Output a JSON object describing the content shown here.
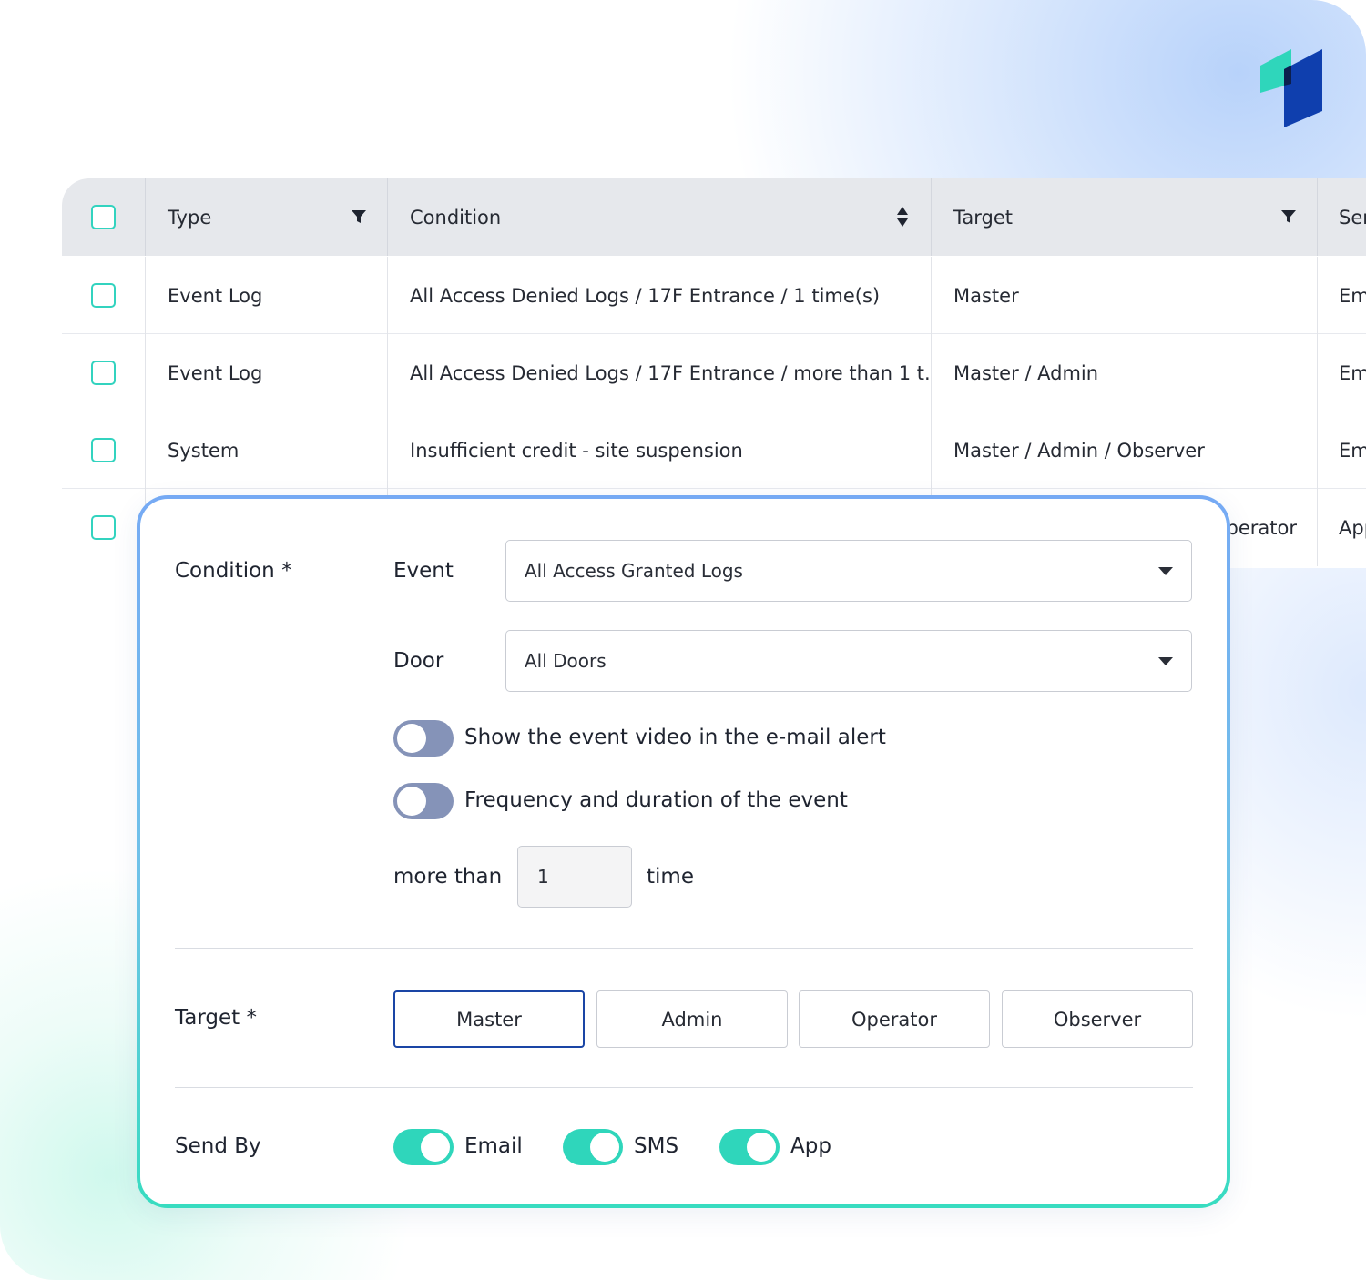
{
  "table": {
    "columns": {
      "type": "Type",
      "condition": "Condition",
      "target": "Target",
      "send_by": "Ser"
    },
    "rows": [
      {
        "type": "Event Log",
        "condition": "All Access Denied Logs / 17F Entrance / 1 time(s)",
        "target": "Master",
        "send_by": "Em"
      },
      {
        "type": "Event Log",
        "condition": "All Access Denied Logs / 17F Entrance / more than 1 t...",
        "target": "Master / Admin",
        "send_by": "Em"
      },
      {
        "type": "System",
        "condition": "Insufficient credit - site suspension",
        "target": "Master / Admin / Observer",
        "send_by": "Em"
      },
      {
        "type": "",
        "condition": "",
        "target": "perator",
        "send_by": "App"
      }
    ]
  },
  "form": {
    "condition_label": "Condition *",
    "event_label": "Event",
    "event_value": "All Access Granted Logs",
    "door_label": "Door",
    "door_value": "All Doors",
    "toggle_video_label": "Show the event video in the e-mail alert",
    "toggle_frequency_label": "Frequency and duration of the event",
    "more_than_label": "more than",
    "count_value": "1",
    "time_label": "time",
    "target_label": "Target *",
    "target_options": [
      "Master",
      "Admin",
      "Operator",
      "Observer"
    ],
    "target_selected": "Master",
    "send_by_label": "Send By",
    "send_by_options": [
      {
        "label": "Email",
        "on": true
      },
      {
        "label": "SMS",
        "on": true
      },
      {
        "label": "App",
        "on": true
      }
    ],
    "toggle_video_on": false,
    "toggle_frequency_on": false
  },
  "colors": {
    "accent_teal": "#2fd6bb",
    "brand_blue": "#1a45a5",
    "toggle_off": "#8593b8"
  },
  "icons": {
    "logo": "brand-logo-icon",
    "filter": "filter-icon",
    "sort": "sort-icon",
    "dropdown": "caret-down-icon"
  }
}
